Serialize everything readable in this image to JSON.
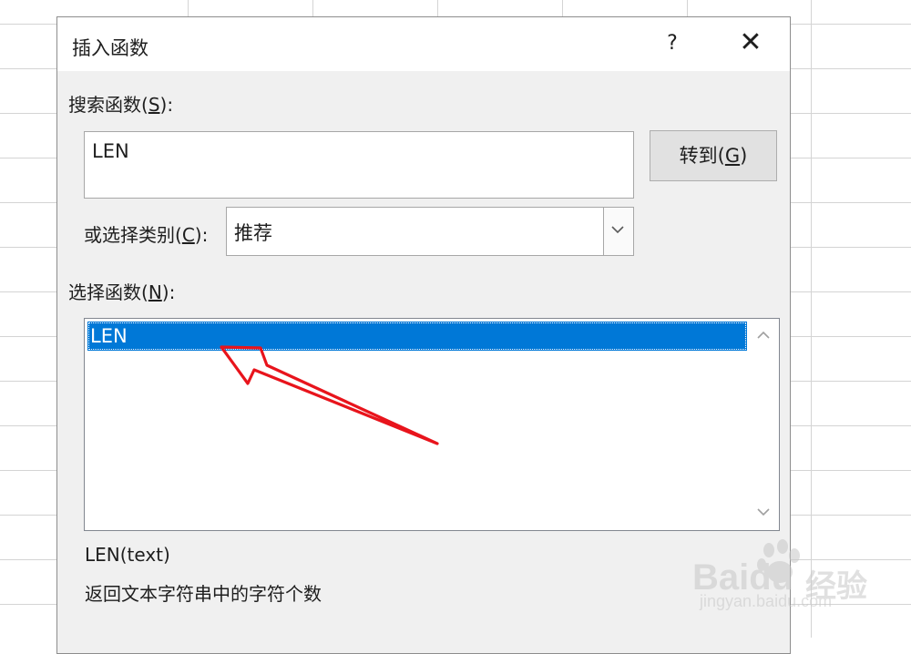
{
  "dialog": {
    "title": "插入函数",
    "help_label": "?",
    "close_label": "✕",
    "search_label_prefix": "搜索函数(",
    "search_label_key": "S",
    "search_label_suffix": "):",
    "search_value": "LEN",
    "goto_prefix": "转到(",
    "goto_key": "G",
    "goto_suffix": ")",
    "category_label_prefix": "或选择类别(",
    "category_label_key": "C",
    "category_label_suffix": "):",
    "category_value": "推荐",
    "select_label_prefix": "选择函数(",
    "select_label_key": "N",
    "select_label_suffix": "):",
    "functions": [
      "LEN"
    ],
    "selected_function": "LEN",
    "syntax": "LEN(text)",
    "description": "返回文本字符串中的字符个数"
  },
  "watermark": {
    "brand": "Baidu",
    "brand_cn": "经验",
    "url": "jingyan.baidu.com"
  },
  "colors": {
    "selection": "#0078d7",
    "annotation_arrow": "#e8141c",
    "dialog_bg": "#f0f0f0"
  }
}
